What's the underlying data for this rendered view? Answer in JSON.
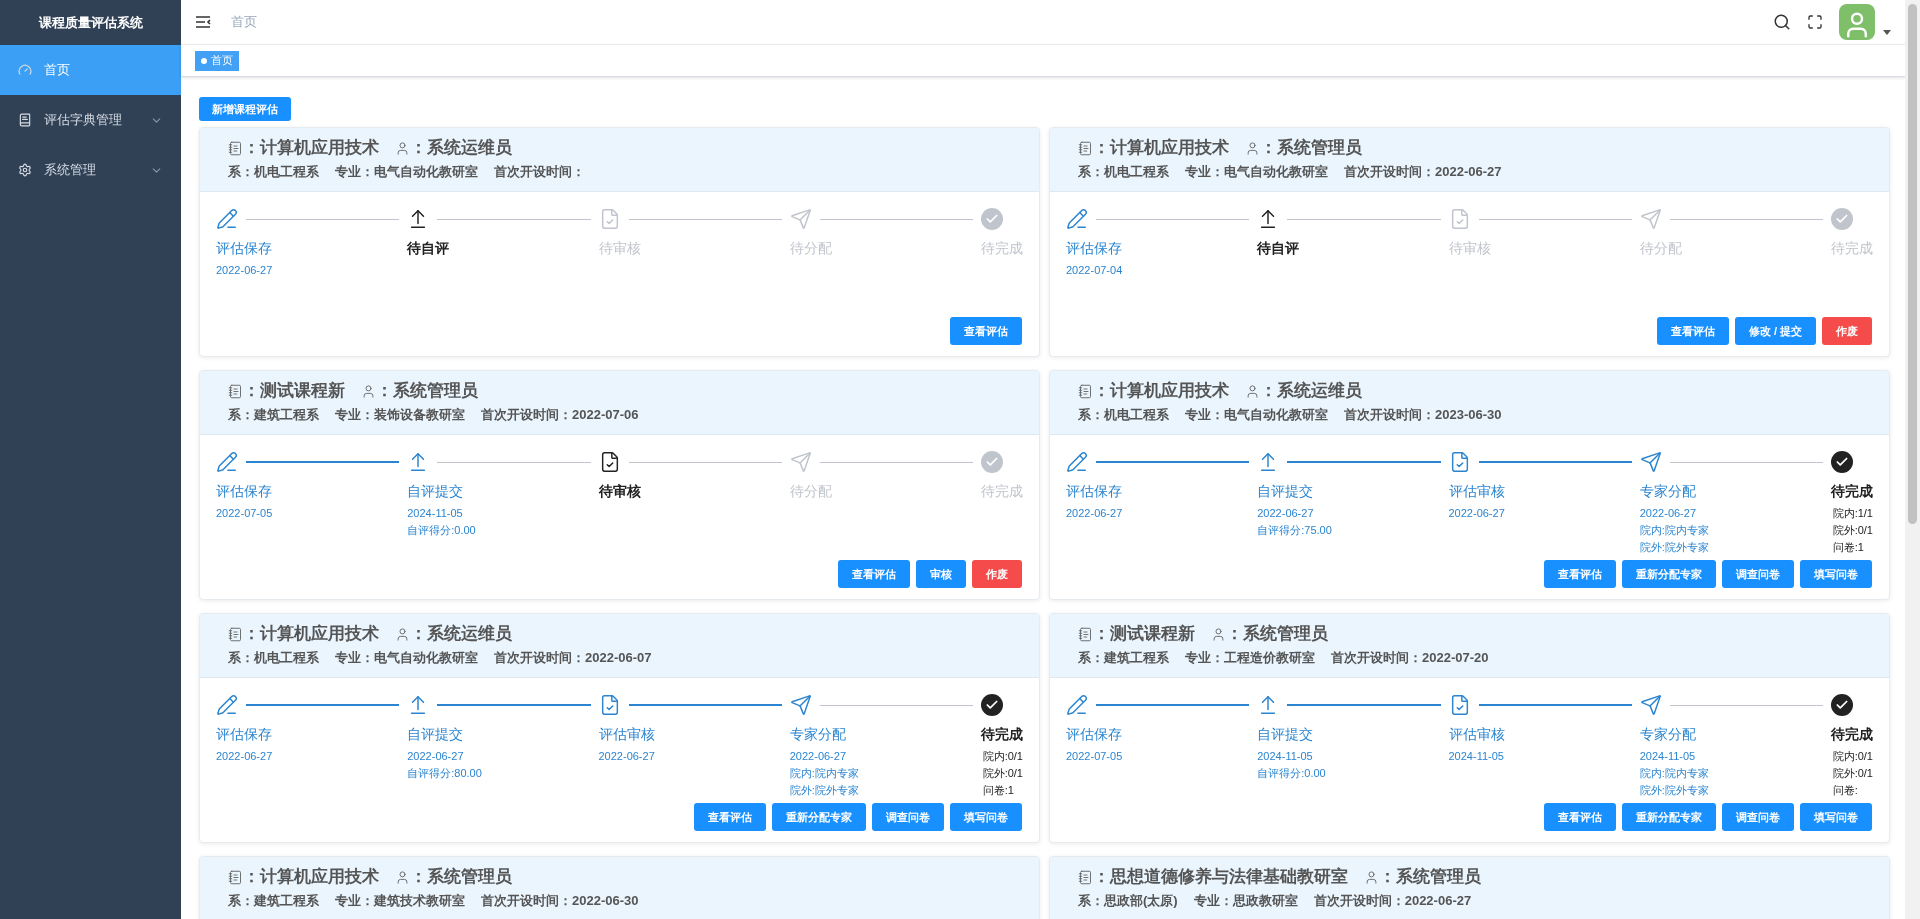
{
  "sidebar": {
    "title": "课程质量评估系统",
    "items": [
      {
        "label": "首页",
        "kind": "link",
        "selected": true
      },
      {
        "label": "评估字典管理",
        "kind": "submenu",
        "selected": false
      },
      {
        "label": "系统管理",
        "kind": "submenu",
        "selected": false
      }
    ]
  },
  "header": {
    "breadcrumb": "首页"
  },
  "tags": [
    {
      "label": "首页",
      "selected": true
    }
  ],
  "new_button": "新增课程评估",
  "cards": [
    {
      "title": "：计算机应用技术",
      "owner": "：系统运维员",
      "department": "系：机电工程系",
      "major": "专业：电气自动化教研室",
      "first_open": "首次开设时间：",
      "steps": [
        {
          "label": "评估保存",
          "done": true,
          "active": false,
          "details": [
            "2022-06-27"
          ]
        },
        {
          "label": "待自评",
          "done": false,
          "active": true
        },
        {
          "label": "待审核",
          "done": false,
          "active": false
        },
        {
          "label": "待分配",
          "done": false,
          "active": false
        },
        {
          "label": "待完成",
          "done": false,
          "active": false
        }
      ],
      "buttons": [
        {
          "label": "查看评估",
          "kind": "primary"
        }
      ]
    },
    {
      "title": "：计算机应用技术",
      "owner": "：系统管理员",
      "department": "系：机电工程系",
      "major": "专业：电气自动化教研室",
      "first_open": "首次开设时间：2022-06-27",
      "steps": [
        {
          "label": "评估保存",
          "done": true,
          "active": false,
          "details": [
            "2022-07-04"
          ]
        },
        {
          "label": "待自评",
          "done": false,
          "active": true
        },
        {
          "label": "待审核",
          "done": false,
          "active": false
        },
        {
          "label": "待分配",
          "done": false,
          "active": false
        },
        {
          "label": "待完成",
          "done": false,
          "active": false
        }
      ],
      "buttons": [
        {
          "label": "查看评估",
          "kind": "primary"
        },
        {
          "label": "修改 / 提交",
          "kind": "primary"
        },
        {
          "label": "作废",
          "kind": "danger"
        }
      ]
    },
    {
      "title": "：测试课程新",
      "owner": "：系统管理员",
      "department": "系：建筑工程系",
      "major": "专业：装饰设备教研室",
      "first_open": "首次开设时间：2022-07-06",
      "steps": [
        {
          "label": "评估保存",
          "done": true,
          "active": false,
          "details": [
            "2022-07-05"
          ]
        },
        {
          "label": "自评提交",
          "done": true,
          "active": false,
          "details": [
            "2024-11-05",
            "自评得分:0.00"
          ]
        },
        {
          "label": "待审核",
          "done": false,
          "active": true
        },
        {
          "label": "待分配",
          "done": false,
          "active": false
        },
        {
          "label": "待完成",
          "done": false,
          "active": false
        }
      ],
      "buttons": [
        {
          "label": "查看评估",
          "kind": "primary"
        },
        {
          "label": "审核",
          "kind": "primary"
        },
        {
          "label": "作废",
          "kind": "danger"
        }
      ]
    },
    {
      "title": "：计算机应用技术",
      "owner": "：系统运维员",
      "department": "系：机电工程系",
      "major": "专业：电气自动化教研室",
      "first_open": "首次开设时间：2023-06-30",
      "steps": [
        {
          "label": "评估保存",
          "done": true,
          "active": false,
          "details": [
            "2022-06-27"
          ]
        },
        {
          "label": "自评提交",
          "done": true,
          "active": false,
          "details": [
            "2022-06-27",
            "自评得分:75.00"
          ]
        },
        {
          "label": "评估审核",
          "done": true,
          "active": false,
          "details": [
            "2022-06-27"
          ]
        },
        {
          "label": "专家分配",
          "done": true,
          "active": false,
          "details": [
            "2022-06-27",
            "院内:院内专家",
            "院外:院外专家"
          ]
        },
        {
          "label": "待完成",
          "done": false,
          "active": true,
          "details": [
            "院内:1/1",
            "院外:0/1",
            "问卷:1"
          ]
        }
      ],
      "buttons": [
        {
          "label": "查看评估",
          "kind": "primary"
        },
        {
          "label": "重新分配专家",
          "kind": "primary"
        },
        {
          "label": "调查问卷",
          "kind": "primary"
        },
        {
          "label": "填写问卷",
          "kind": "primary"
        }
      ]
    },
    {
      "title": "：计算机应用技术",
      "owner": "：系统运维员",
      "department": "系：机电工程系",
      "major": "专业：电气自动化教研室",
      "first_open": "首次开设时间：2022-06-07",
      "steps": [
        {
          "label": "评估保存",
          "done": true,
          "active": false,
          "details": [
            "2022-06-27"
          ]
        },
        {
          "label": "自评提交",
          "done": true,
          "active": false,
          "details": [
            "2022-06-27",
            "自评得分:80.00"
          ]
        },
        {
          "label": "评估审核",
          "done": true,
          "active": false,
          "details": [
            "2022-06-27"
          ]
        },
        {
          "label": "专家分配",
          "done": true,
          "active": false,
          "details": [
            "2022-06-27",
            "院内:院内专家",
            "院外:院外专家"
          ]
        },
        {
          "label": "待完成",
          "done": false,
          "active": true,
          "details": [
            "院内:0/1",
            "院外:0/1",
            "问卷:1"
          ]
        }
      ],
      "buttons": [
        {
          "label": "查看评估",
          "kind": "primary"
        },
        {
          "label": "重新分配专家",
          "kind": "primary"
        },
        {
          "label": "调查问卷",
          "kind": "primary"
        },
        {
          "label": "填写问卷",
          "kind": "primary"
        }
      ]
    },
    {
      "title": "：测试课程新",
      "owner": "：系统管理员",
      "department": "系：建筑工程系",
      "major": "专业：工程造价教研室",
      "first_open": "首次开设时间：2022-07-20",
      "steps": [
        {
          "label": "评估保存",
          "done": true,
          "active": false,
          "details": [
            "2022-07-05"
          ]
        },
        {
          "label": "自评提交",
          "done": true,
          "active": false,
          "details": [
            "2024-11-05",
            "自评得分:0.00"
          ]
        },
        {
          "label": "评估审核",
          "done": true,
          "active": false,
          "details": [
            "2024-11-05"
          ]
        },
        {
          "label": "专家分配",
          "done": true,
          "active": false,
          "details": [
            "2024-11-05",
            "院内:院内专家",
            "院外:院外专家"
          ]
        },
        {
          "label": "待完成",
          "done": false,
          "active": true,
          "details": [
            "院内:0/1",
            "院外:0/1",
            "问卷:"
          ]
        }
      ],
      "buttons": [
        {
          "label": "查看评估",
          "kind": "primary"
        },
        {
          "label": "重新分配专家",
          "kind": "primary"
        },
        {
          "label": "调查问卷",
          "kind": "primary"
        },
        {
          "label": "填写问卷",
          "kind": "primary"
        }
      ]
    },
    {
      "title": "：计算机应用技术",
      "owner": "：系统管理员",
      "department": "系：建筑工程系",
      "major": "专业：建筑技术教研室",
      "first_open": "首次开设时间：2022-06-30"
    },
    {
      "title": "：思想道德修养与法律基础教研室",
      "owner": "：系统管理员",
      "department": "系：思政部(太原)",
      "major": "专业：思政教研室",
      "first_open": "首次开设时间：2022-06-27"
    }
  ]
}
